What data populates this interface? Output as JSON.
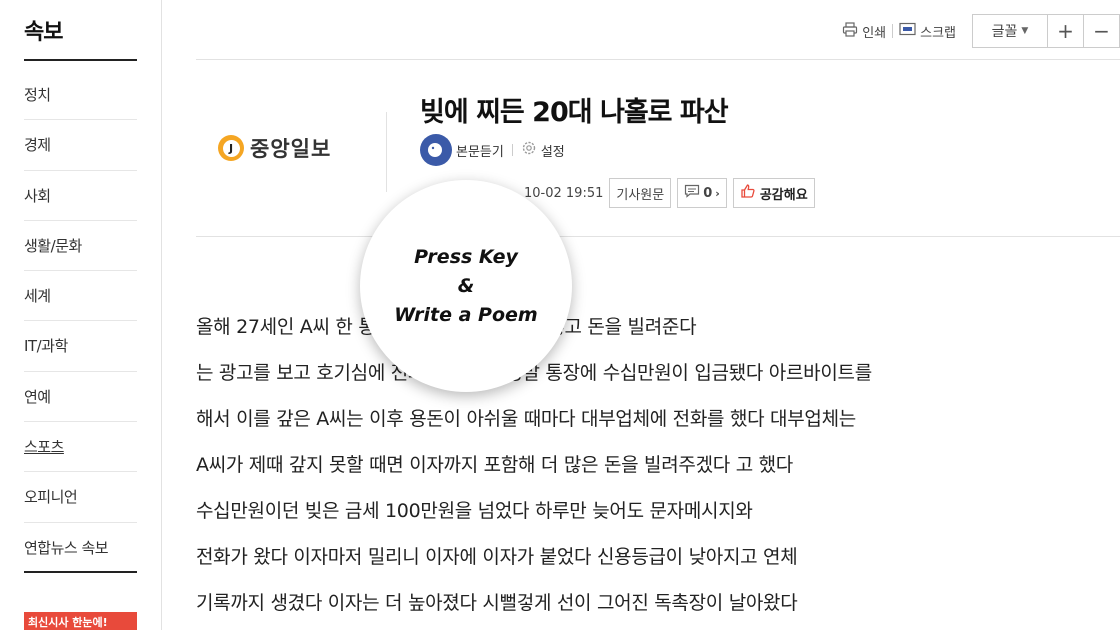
{
  "sidebar": {
    "title": "속보",
    "items": [
      "정치",
      "경제",
      "사회",
      "생활/문화",
      "세계",
      "IT/과학",
      "연예",
      "스포츠",
      "오피니언",
      "연합뉴스 속보"
    ],
    "banner": "최신시사 한눈에!"
  },
  "toolbar": {
    "print": "인쇄",
    "scrap": "스크랩",
    "font": "글꼴",
    "plus": "+",
    "minus": "−"
  },
  "article": {
    "press": "중앙일보",
    "press_mark": "J",
    "title": "빚에 찌든 20대 나홀로 파산",
    "listen": "본문듣기",
    "settings": "설정",
    "timestamp": "10-02 19:51",
    "original": "기사원문",
    "comments": "0",
    "like": "공감해요",
    "body_lines": [
      "올해 27세인  A씨  한 통화면 묻지도 따지지도  않고 돈을 빌려준다",
      "는 광고를 보고 호기심에  전화를 걸었다 정말 통장에 수십만원이  입금됐다  아르바이트를",
      "해서 이를 갚은 A씨는  이후 용돈이 아쉬울 때마다 대부업체에  전화를 했다 대부업체는",
      "A씨가  제때 갚지 못할 때면 이자까지  포함해 더 많은 돈을 빌려주겠다  고 했다",
      "수십만원이던  빚은 금세 100만원을       넘었다 하루만 늦어도 문자메시지와",
      "전화가 왔다 이자마저  밀리니 이자에 이자가 붙었다 신용등급이  낮아지고  연체",
      "기록까지  생겼다 이자는 더 높아졌다  시뻘겋게  선이 그어진 독촉장이  날아왔다"
    ]
  },
  "overlay": {
    "line1": "Press Key",
    "line2": "&",
    "line3": "Write a Poem"
  },
  "colors": {
    "brand_orange": "#f5a623",
    "listen_blue": "#3b5aa8",
    "like_red": "#e84a3b"
  }
}
